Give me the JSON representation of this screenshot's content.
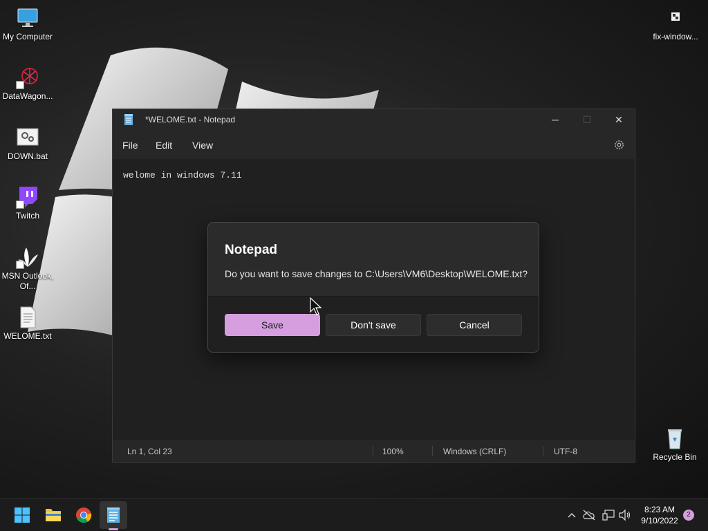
{
  "desktop": {
    "icons": [
      {
        "label": "My Computer",
        "icon": "computer-icon"
      },
      {
        "label": "DataWagon...",
        "icon": "datawagon-icon"
      },
      {
        "label": "DOWN.bat",
        "icon": "batch-file-icon"
      },
      {
        "label": "Twitch",
        "icon": "twitch-icon"
      },
      {
        "label": "MSN Outlook, Of...",
        "icon": "msn-icon"
      },
      {
        "label": "WELOME.txt",
        "icon": "text-file-icon"
      },
      {
        "label": "fix-window...",
        "icon": "fix-window-icon"
      },
      {
        "label": "Recycle Bin",
        "icon": "recycle-bin-icon"
      }
    ]
  },
  "notepad": {
    "title": "*WELOME.txt - Notepad",
    "menu": [
      "File",
      "Edit",
      "View"
    ],
    "content": "welome in windows 7.11",
    "status": {
      "position": "Ln 1, Col 23",
      "zoom": "100%",
      "line_ending": "Windows (CRLF)",
      "encoding": "UTF-8"
    }
  },
  "dialog": {
    "title": "Notepad",
    "message": "Do you want to save changes to C:\\Users\\VM6\\Desktop\\WELOME.txt?",
    "buttons": {
      "save": "Save",
      "dont_save": "Don't save",
      "cancel": "Cancel"
    }
  },
  "taskbar": {
    "time": "8:23 AM",
    "date": "9/10/2022",
    "notification_count": "2"
  },
  "colors": {
    "accent": "#d59ede",
    "window_bg": "#202020",
    "dialog_bg": "#2b2b2b"
  }
}
